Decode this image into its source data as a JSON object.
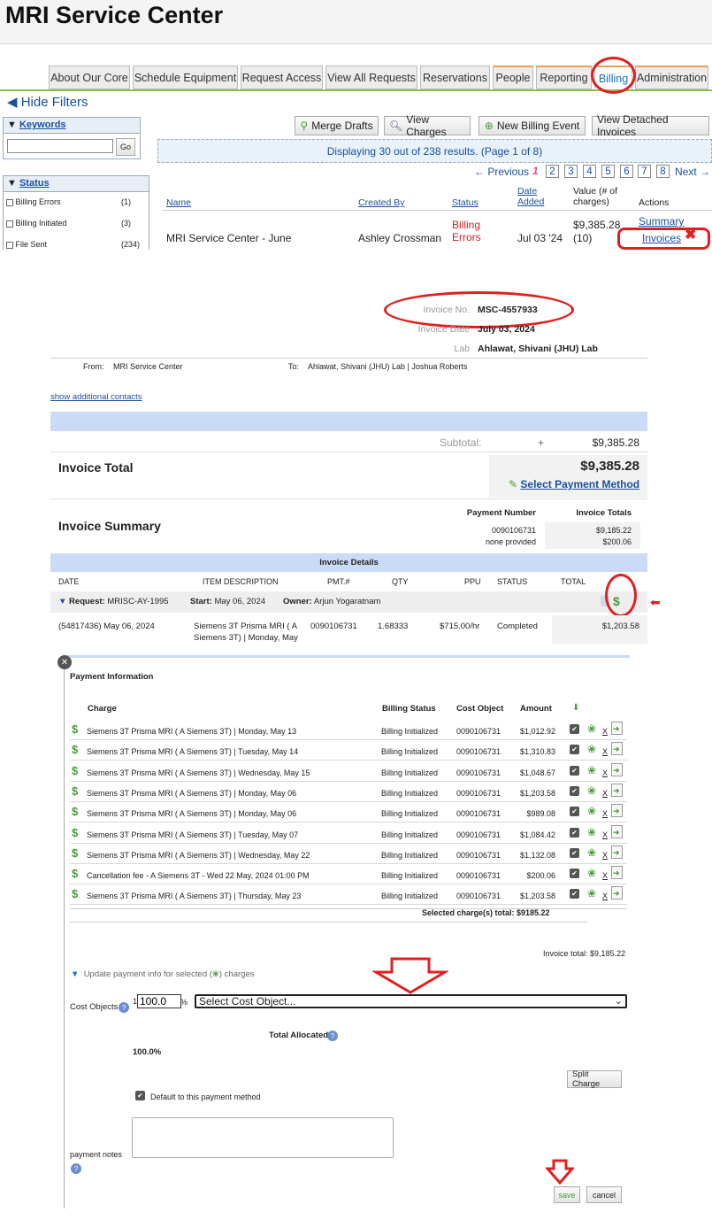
{
  "app": {
    "title": "MRI Service Center"
  },
  "nav": {
    "tabs": [
      "About Our Core",
      "Schedule Equipment",
      "Request Access",
      "View All Requests",
      "Reservations",
      "People",
      "Reporting",
      "Billing",
      "Administration"
    ]
  },
  "filters": {
    "hide_label": "Hide Filters",
    "keywords": {
      "title": "Keywords",
      "go": "Go",
      "value": ""
    },
    "status": {
      "title": "Status",
      "items": [
        {
          "label": "Billing Errors",
          "count": "(1)"
        },
        {
          "label": "Billing Initiated",
          "count": "(3)"
        },
        {
          "label": "File Sent",
          "count": "(234)"
        }
      ]
    }
  },
  "toolbar": {
    "merge": "Merge Drafts",
    "view_charges": "View Charges",
    "new_event": "New Billing Event",
    "detached": "View Detached Invoices"
  },
  "results": {
    "banner": "Displaying 30 out of 238 results. (Page 1 of 8)",
    "prev": "← Previous",
    "current": "1",
    "pages": [
      "2",
      "3",
      "4",
      "5",
      "6",
      "7",
      "8"
    ],
    "next": "Next →"
  },
  "table": {
    "headers": {
      "name": "Name",
      "created_by": "Created By",
      "status": "Status",
      "date": "Date Added",
      "value": "Value (# of charges)",
      "actions": "Actions"
    },
    "row": {
      "name": "MRI Service Center - June",
      "created_by": "Ashley Crossman",
      "status": "Billing Errors",
      "date": "Jul 03 '24",
      "value": "$9,385.28",
      "count": "(10)",
      "summary": "Summary",
      "invoices": "Invoices"
    }
  },
  "invoice": {
    "no_label": "Invoice No.",
    "no": "MSC-4557933",
    "date_label": "Invoice Date",
    "date": "July 03, 2024",
    "lab_label": "Lab",
    "lab": "Ahlawat, Shivani (JHU) Lab",
    "from_label": "From:",
    "from": "MRI Service Center",
    "to_label": "To:",
    "to": "Ahlawat, Shivani (JHU) Lab | Joshua Roberts",
    "contacts": "show additional contacts",
    "subtotal_label": "Subtotal:",
    "plus": "+",
    "subtotal": "$9,385.28",
    "total_label": "Invoice Total",
    "total": "$9,385.28",
    "select_payment": "Select Payment Method",
    "summary_label": "Invoice Summary",
    "pay_num_h": "Payment Number",
    "pay_tot_h": "Invoice Totals",
    "summary_rows": [
      {
        "num": "0090106731",
        "total": "$9,185.22"
      },
      {
        "num": "none provided",
        "total": "$200.06"
      }
    ],
    "details_label": "Invoice Details",
    "detail_headers": [
      "DATE",
      "ITEM DESCRIPTION",
      "PMT.#",
      "QTY",
      "PPU",
      "STATUS",
      "TOTAL"
    ],
    "request": {
      "label": "Request:",
      "id": "MRISC-AY-1995",
      "start_label": "Start:",
      "start": "May 06, 2024",
      "owner_label": "Owner:",
      "owner": "Arjun Yogaratnam"
    },
    "detail_row": {
      "date": "(54817436) May 06, 2024",
      "desc1": "Siemens 3T Prisma MRI ( A",
      "desc2": "Siemens 3T) | Monday, May",
      "pmt": "0090106731",
      "qty": "1.68333",
      "ppu": "$715.00/hr",
      "status": "Completed",
      "total": "$1,203.58"
    }
  },
  "payment": {
    "title": "Payment Information",
    "headers": {
      "charge": "Charge",
      "status": "Billing Status",
      "cost": "Cost Object",
      "amount": "Amount"
    },
    "rows": [
      {
        "charge": "Siemens 3T Prisma MRI ( A Siemens 3T) | Monday, May 13",
        "status": "Billing Initialized",
        "cost": "0090106731",
        "amount": "$1,012.92"
      },
      {
        "charge": "Siemens 3T Prisma MRI ( A Siemens 3T) | Tuesday, May 14",
        "status": "Billing Initialized",
        "cost": "0090106731",
        "amount": "$1,310.83"
      },
      {
        "charge": "Siemens 3T Prisma MRI ( A Siemens 3T) | Wednesday, May 15",
        "status": "Billing Initialized",
        "cost": "0090106731",
        "amount": "$1,048.67"
      },
      {
        "charge": "Siemens 3T Prisma MRI ( A Siemens 3T) | Monday, May 06",
        "status": "Billing Initialized",
        "cost": "0090106731",
        "amount": "$1,203.58"
      },
      {
        "charge": "Siemens 3T Prisma MRI ( A Siemens 3T) | Monday, May 06",
        "status": "Billing Initialized",
        "cost": "0090106731",
        "amount": "$989.08"
      },
      {
        "charge": "Siemens 3T Prisma MRI ( A Siemens 3T) | Tuesday, May 07",
        "status": "Billing Initialized",
        "cost": "0090106731",
        "amount": "$1,084.42"
      },
      {
        "charge": "Siemens 3T Prisma MRI ( A Siemens 3T) | Wednesday, May 22",
        "status": "Billing Initialized",
        "cost": "0090106731",
        "amount": "$1,132.08"
      },
      {
        "charge": "Cancellation fee - A Siemens 3T - Wed 22 May, 2024 01:00 PM",
        "status": "Billing Initialized",
        "cost": "0090106731",
        "amount": "$200.06"
      },
      {
        "charge": "Siemens 3T Prisma MRI ( A Siemens 3T) | Thursday, May 23",
        "status": "Billing Initialized",
        "cost": "0090106731",
        "amount": "$1,203.58"
      }
    ],
    "x_label": "X",
    "selected_total": "Selected charge(s) total: $9185.22",
    "invoice_total": "Invoice total: $9,185.22",
    "update_label": "Update payment info for selected (",
    "update_label2": ") charges",
    "cost_objects_label": "Cost Objects",
    "cost_num": "1",
    "percent_value": "100.0",
    "percent_sign": "%",
    "select_placeholder": "Select Cost Object...",
    "total_allocated": "Total Allocated",
    "allocated_value": "100.0%",
    "split": "Split Charge",
    "default_label": "Default to this payment method",
    "notes_label": "payment notes",
    "save": "save",
    "cancel": "cancel"
  },
  "colors": {
    "accent": "#1a4fa3",
    "annotation": "#e02020",
    "light_blue": "#c9dbf7",
    "green": "#8fc04a"
  }
}
